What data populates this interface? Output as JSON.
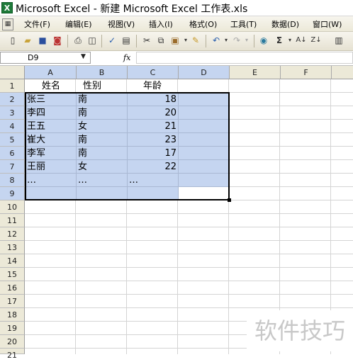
{
  "window": {
    "title": "Microsoft Excel - 新建 Microsoft Excel 工作表.xls",
    "app_icon": "X"
  },
  "menu": {
    "items": [
      "文件(F)",
      "编辑(E)",
      "视图(V)",
      "插入(I)",
      "格式(O)",
      "工具(T)",
      "数据(D)",
      "窗口(W)"
    ]
  },
  "toolbar": {
    "icons": [
      "new-icon",
      "open-icon",
      "save-icon",
      "permission-icon",
      "print-icon",
      "print-preview-icon",
      "spelling-icon",
      "research-icon",
      "cut-icon",
      "copy-icon",
      "paste-icon",
      "format-painter-icon",
      "undo-icon",
      "redo-icon",
      "hyperlink-icon",
      "autosum-icon",
      "sort-ascending-icon",
      "sort-descending-icon"
    ],
    "sum_label": "Σ"
  },
  "formula_bar": {
    "name_box": "D9",
    "fx_label": "fx",
    "formula": ""
  },
  "sheet": {
    "columns": [
      "A",
      "B",
      "C",
      "D",
      "E",
      "F"
    ],
    "selected_columns": [
      "A",
      "B",
      "C",
      "D"
    ],
    "rows": [
      "1",
      "2",
      "3",
      "4",
      "5",
      "6",
      "7",
      "8",
      "9",
      "10",
      "11",
      "12",
      "13",
      "14",
      "15",
      "16",
      "17",
      "18",
      "19",
      "20",
      "21"
    ],
    "selected_rows": [
      "2",
      "3",
      "4",
      "5",
      "6",
      "7",
      "8",
      "9"
    ],
    "selection": "A2:D9",
    "active_cell": "D9",
    "headers": {
      "name": "姓名",
      "gender": "性别",
      "age": "年龄"
    },
    "data_rows": [
      {
        "name": "张三",
        "gender": "南",
        "age": "18"
      },
      {
        "name": "李四",
        "gender": "南",
        "age": "20"
      },
      {
        "name": "王五",
        "gender": "女",
        "age": "21"
      },
      {
        "name": "崔大",
        "gender": "南",
        "age": "23"
      },
      {
        "name": "李军",
        "gender": "南",
        "age": "17"
      },
      {
        "name": "王丽",
        "gender": "女",
        "age": "22"
      },
      {
        "name": "…",
        "gender": "…",
        "age": "…"
      }
    ],
    "selection_color": "#c5d5f0"
  },
  "watermark": {
    "text": "软件技巧"
  }
}
